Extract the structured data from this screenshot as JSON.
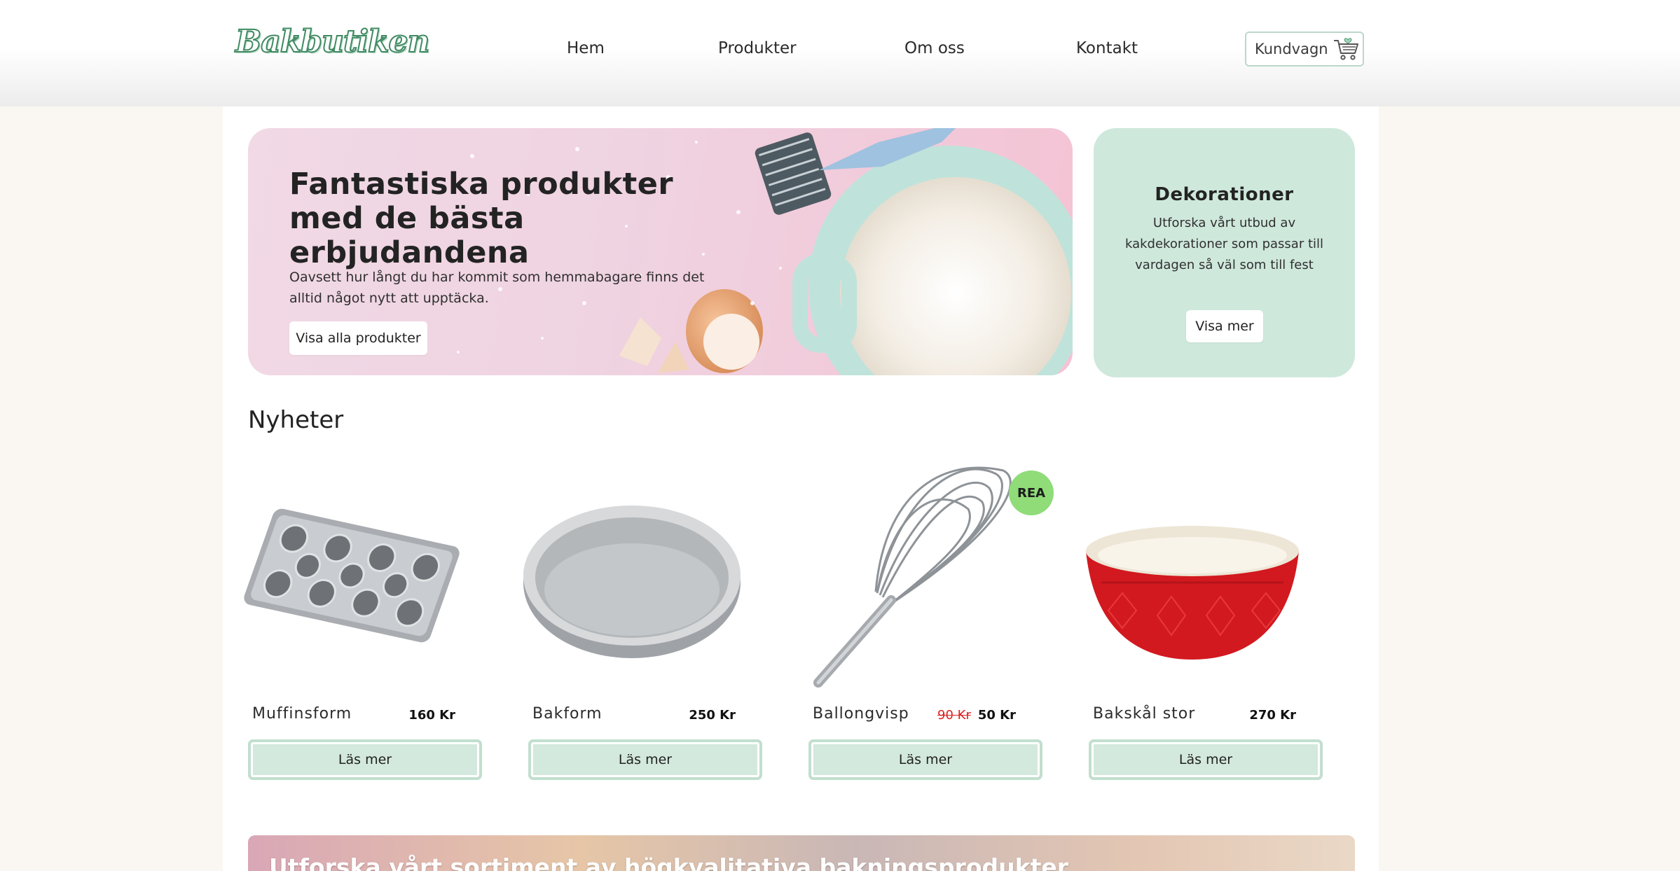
{
  "header": {
    "logo": "Bakbutiken",
    "nav": [
      {
        "label": "Hem"
      },
      {
        "label": "Produkter"
      },
      {
        "label": "Om oss"
      },
      {
        "label": "Kontakt"
      }
    ],
    "cart_label": "Kundvagn",
    "cart_icon": "cart-icon"
  },
  "hero": {
    "title": "Fantastiska produkter med de bästa erbjudandena",
    "text": "Oavsett hur långt du har kommit som hemmabagare finns det alltid något nytt att upptäcka.",
    "button": "Visa alla produkter"
  },
  "decorations": {
    "title": "Dekorationer",
    "text": "Utforska vårt utbud av kakdekorationer som passar till vardagen så väl som till fest",
    "button": "Visa mer"
  },
  "news": {
    "title": "Nyheter",
    "products": [
      {
        "name": "Muffinsform",
        "price": "160 Kr",
        "button": "Läs mer"
      },
      {
        "name": "Bakform",
        "price": "250 Kr",
        "button": "Läs mer"
      },
      {
        "name": "Ballongvisp",
        "old_price": "90 Kr",
        "price": "50 Kr",
        "badge": "REA",
        "button": "Läs mer"
      },
      {
        "name": "Bakskål stor",
        "price": "270 Kr",
        "button": "Läs mer"
      }
    ]
  },
  "banner": {
    "title": "Utforska vårt sortiment av högkvalitativa bakningsprodukter"
  },
  "colors": {
    "accent_green": "#cfe8dc",
    "sale_badge": "#8fdc79",
    "old_price": "#dd2222"
  }
}
